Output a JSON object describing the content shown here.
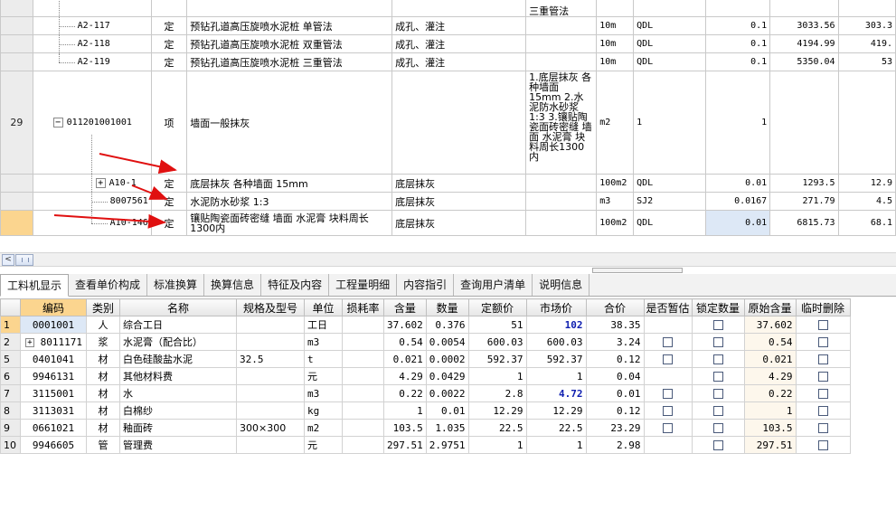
{
  "top_rows": [
    {
      "rowno": "",
      "code": "",
      "type": "",
      "name": "",
      "feature": "",
      "feature2": "三重管法",
      "unit": "",
      "qty_expr": "",
      "qty": "",
      "price": "",
      "total": ""
    },
    {
      "rowno": "",
      "code": "A2-117",
      "type": "定",
      "name": "预钻孔道高压旋喷水泥桩 单管法",
      "feature": "成孔、灌注",
      "feature2": "",
      "unit": "10m",
      "qty_expr": "QDL",
      "qty": "0.1",
      "price": "3033.56",
      "total": "303.3"
    },
    {
      "rowno": "",
      "code": "A2-118",
      "type": "定",
      "name": "预钻孔道高压旋喷水泥桩 双重管法",
      "feature": "成孔、灌注",
      "feature2": "",
      "unit": "10m",
      "qty_expr": "QDL",
      "qty": "0.1",
      "price": "4194.99",
      "total": "419."
    },
    {
      "rowno": "",
      "code": "A2-119",
      "type": "定",
      "name": "预钻孔道高压旋喷水泥桩 三重管法",
      "feature": "成孔、灌注",
      "feature2": "",
      "unit": "10m",
      "qty_expr": "QDL",
      "qty": "0.1",
      "price": "5350.04",
      "total": "53"
    },
    {
      "rowno": "29",
      "code": "011201001001",
      "type": "项",
      "name": "墙面一般抹灰",
      "feature": "",
      "feature2": "1.底层抹灰 各种墙面 15mm 2.水泥防水砂浆 1:3 3.镶贴陶瓷面砖密缝 墙面 水泥膏 块料周长1300内",
      "unit": "m2",
      "qty_expr": "1",
      "qty": "1",
      "price": "",
      "total": ""
    },
    {
      "rowno": "",
      "code": "A10-1",
      "type": "定",
      "name": "底层抹灰 各种墙面 15mm",
      "feature": "底层抹灰",
      "feature2": "",
      "unit": "100m2",
      "qty_expr": "QDL",
      "qty": "0.01",
      "price": "1293.5",
      "total": "12.9"
    },
    {
      "rowno": "",
      "code": "8007561",
      "type": "定",
      "name": "水泥防水砂浆 1:3",
      "feature": "底层抹灰",
      "feature2": "",
      "unit": "m3",
      "qty_expr": "SJ2",
      "qty": "0.0167",
      "price": "271.79",
      "total": "4.5"
    },
    {
      "rowno": "",
      "code": "A10-146",
      "type": "定",
      "name": "镶贴陶瓷面砖密缝 墙面 水泥膏 块料周长1300内",
      "feature": "底层抹灰",
      "feature2": "",
      "unit": "100m2",
      "qty_expr": "QDL",
      "qty": "0.01",
      "price": "6815.73",
      "total": "68.1"
    }
  ],
  "tabs": [
    "工料机显示",
    "查看单价构成",
    "标准换算",
    "换算信息",
    "特征及内容",
    "工程量明细",
    "内容指引",
    "查询用户清单",
    "说明信息"
  ],
  "bottom": {
    "headers": {
      "code": "编码",
      "cat": "类别",
      "name": "名称",
      "spec": "规格及型号",
      "unit": "单位",
      "loss": "损耗率",
      "content": "含量",
      "qty": "数量",
      "fixed_price": "定额价",
      "market_price": "市场价",
      "total": "合价",
      "tentative": "是否暂估",
      "lock_qty": "锁定数量",
      "orig_content": "原始含量",
      "temp_delete": "临时删除"
    },
    "rows": [
      {
        "rowno": "1",
        "code": "0001001",
        "cat": "人",
        "name": "综合工日",
        "spec": "",
        "unit": "工日",
        "loss": "",
        "content": "37.602",
        "qty": "0.376",
        "fixed_price": "51",
        "market_price": "102",
        "total": "38.35",
        "orig_content": "37.602"
      },
      {
        "rowno": "2",
        "code": "8011171",
        "cat": "浆",
        "name": "水泥膏（配合比）",
        "spec": "",
        "unit": "m3",
        "loss": "",
        "content": "0.54",
        "qty": "0.0054",
        "fixed_price": "600.03",
        "market_price": "600.03",
        "total": "3.24",
        "orig_content": "0.54"
      },
      {
        "rowno": "5",
        "code": "0401041",
        "cat": "材",
        "name": "白色硅酸盐水泥",
        "spec": "32.5",
        "unit": "t",
        "loss": "",
        "content": "0.021",
        "qty": "0.0002",
        "fixed_price": "592.37",
        "market_price": "592.37",
        "total": "0.12",
        "orig_content": "0.021"
      },
      {
        "rowno": "6",
        "code": "9946131",
        "cat": "材",
        "name": "其他材料费",
        "spec": "",
        "unit": "元",
        "loss": "",
        "content": "4.29",
        "qty": "0.0429",
        "fixed_price": "1",
        "market_price": "1",
        "total": "0.04",
        "orig_content": "4.29"
      },
      {
        "rowno": "7",
        "code": "3115001",
        "cat": "材",
        "name": "水",
        "spec": "",
        "unit": "m3",
        "loss": "",
        "content": "0.22",
        "qty": "0.0022",
        "fixed_price": "2.8",
        "market_price": "4.72",
        "total": "0.01",
        "orig_content": "0.22"
      },
      {
        "rowno": "8",
        "code": "3113031",
        "cat": "材",
        "name": "白棉纱",
        "spec": "",
        "unit": "kg",
        "loss": "",
        "content": "1",
        "qty": "0.01",
        "fixed_price": "12.29",
        "market_price": "12.29",
        "total": "0.12",
        "orig_content": "1"
      },
      {
        "rowno": "9",
        "code": "0661021",
        "cat": "材",
        "name": "釉面砖",
        "spec": "300×300",
        "unit": "m2",
        "loss": "",
        "content": "103.5",
        "qty": "1.035",
        "fixed_price": "22.5",
        "market_price": "22.5",
        "total": "23.29",
        "orig_content": "103.5"
      },
      {
        "rowno": "10",
        "code": "9946605",
        "cat": "管",
        "name": "管理费",
        "spec": "",
        "unit": "元",
        "loss": "",
        "content": "297.51",
        "qty": "2.9751",
        "fixed_price": "1",
        "market_price": "1",
        "total": "2.98",
        "orig_content": "297.51"
      }
    ]
  },
  "colors": {
    "selection": "#fbd58f",
    "highlight": "#dde8f6",
    "arrow": "#e01010",
    "market_changed": "#1020b0"
  },
  "icons": {
    "expand": "plus-box-icon",
    "collapse": "minus-box-icon",
    "scroll_left": "scroll-left-arrow-icon"
  }
}
